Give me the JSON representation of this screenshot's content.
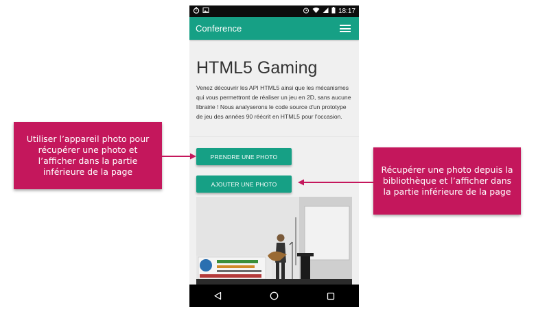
{
  "status_bar": {
    "time": "18:17"
  },
  "app_bar": {
    "title": "Conference",
    "menu_icon": "hamburger-icon"
  },
  "article": {
    "title": "HTML5 Gaming",
    "description": "Venez découvrir les API HTML5 ainsi que les mécanismes qui vous permettront de réaliser un jeu en 2D, sans aucune librairie ! Nous analyserons le code source d'un prototype de jeu des années 90 réécrit en HTML5 pour l'occasion."
  },
  "buttons": {
    "take_photo": "PRENDRE UNE PHOTO",
    "add_photo": "AJOUTER UNE PHOTO"
  },
  "nav_bar": {
    "back_icon": "back-triangle-icon",
    "home_icon": "home-circle-icon",
    "recents_icon": "recents-square-icon"
  },
  "callouts": {
    "left": "Utiliser l’appareil photo pour récupérer une photo et l’afficher dans la partie inférieure de la page",
    "right": "Récupérer une photo depuis la bibliothèque et l’afficher dans la partie inférieure de la page"
  },
  "colors": {
    "accent": "#16a085",
    "callout": "#c4175c",
    "status_bar": "#0d0d0d"
  }
}
